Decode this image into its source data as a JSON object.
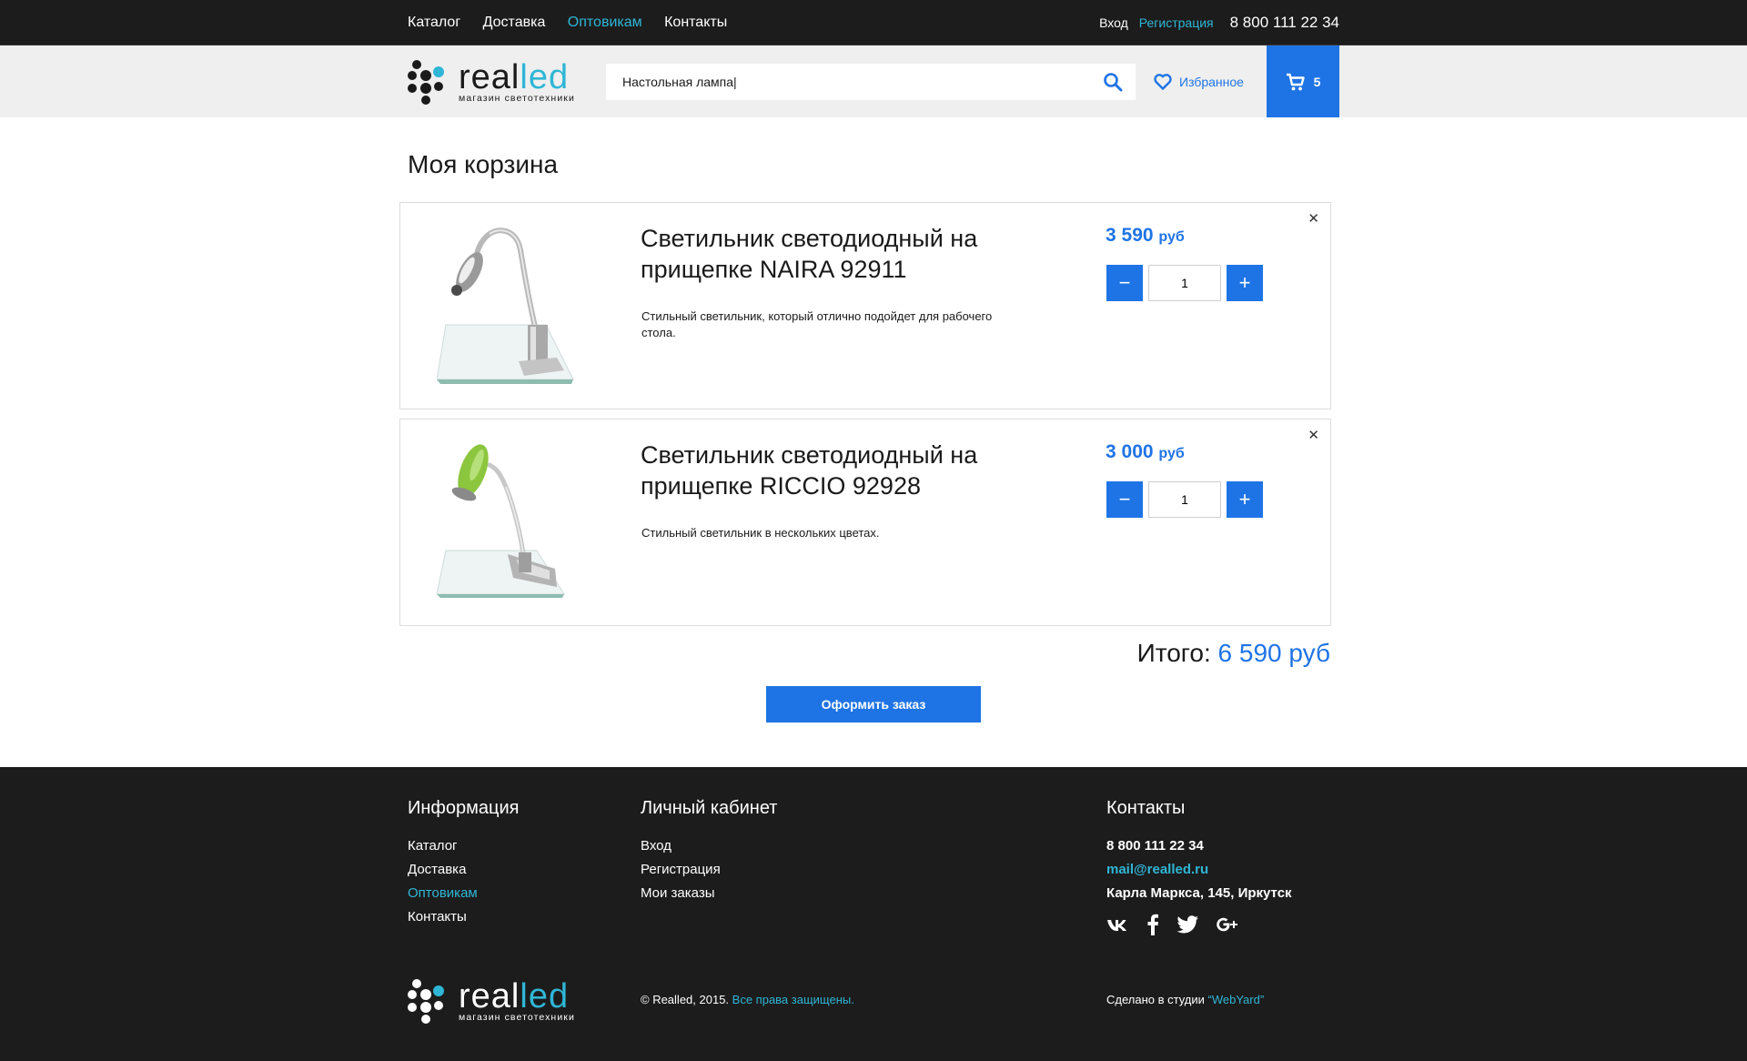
{
  "topbar": {
    "nav": [
      "Каталог",
      "Доставка",
      "Оптовикам",
      "Контакты"
    ],
    "login": "Вход",
    "register": "Регистрация",
    "phone": "8 800 111 22 34"
  },
  "logo": {
    "word_real": "real",
    "word_led": "led",
    "subtitle": "магазин светотехники"
  },
  "header": {
    "search_value": "Настольная лампа|",
    "favorites": "Избранное",
    "cart_count": "5"
  },
  "main": {
    "title": "Моя корзина",
    "items": [
      {
        "title": "Светильник светодиодный на прищепке NAIRA 92911",
        "description": "Стильный светильник, который отлично подойдет для рабочего стола.",
        "price": "3 590",
        "currency": "руб",
        "qty": "1"
      },
      {
        "title": "Светильник светодиодный на прищепке RICCIO 92928",
        "description": "Стильный светильник в нескольких цветах.",
        "price": "3 000",
        "currency": "руб",
        "qty": "1"
      }
    ],
    "total_label": "Итого:",
    "total_value": "6 590 руб",
    "order_button": "Оформить заказ"
  },
  "footer": {
    "info_title": "Информация",
    "info_links": [
      "Каталог",
      "Доставка",
      "Оптовикам",
      "Контакты"
    ],
    "account_title": "Личный кабинет",
    "account_links": [
      "Вход",
      "Регистрация",
      "Мои заказы"
    ],
    "contacts_title": "Контакты",
    "phone": "8 800 111 22 34",
    "email": "mail@realled.ru",
    "address": "Карла Маркса, 145, Иркутск",
    "social": [
      "vk-icon",
      "facebook-icon",
      "twitter-icon",
      "google-plus-icon"
    ],
    "copyright": "© Realled, 2015.",
    "rights": "Все права защищены.",
    "studio_prefix": "Сделано в студии",
    "studio_name": "“WebYard”"
  },
  "colors": {
    "accent": "#1f74e5",
    "cyan": "#2fb6d6",
    "dark": "#1c1c1c"
  }
}
